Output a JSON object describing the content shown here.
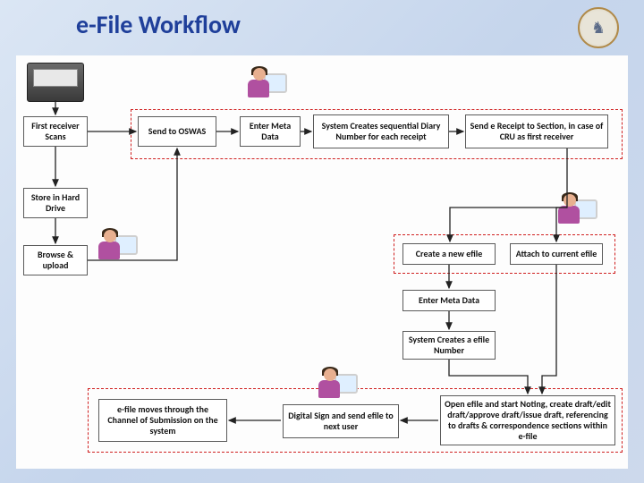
{
  "title": "e-File Workflow",
  "emblem_label": "odisha-emblem",
  "boxes": {
    "first_receiver_scans": "First receiver Scans",
    "store_hard_drive": "Store in Hard Drive",
    "browse_upload": "Browse & upload",
    "send_oswas": "Send to OSWAS",
    "enter_meta_data_1": "Enter Meta Data",
    "diary_number": "System Creates sequential Diary Number for each receipt",
    "send_e_receipt": "Send e Receipt to Section, in case of CRU as first receiver",
    "create_new_efile": "Create a new efile",
    "attach_current_efile": "Attach to current efile",
    "enter_meta_data_2": "Enter Meta Data",
    "efile_number": "System Creates a efile Number",
    "open_efile_noting": "Open efile and start Noting, create draft/edit draft/approve draft/issue draft, referencing to drafts & correspondence sections within e-file",
    "digital_sign_send": "Digital Sign and send efile to next user",
    "efile_moves_channel": "e-file moves through the Channel of Submission on the system"
  }
}
